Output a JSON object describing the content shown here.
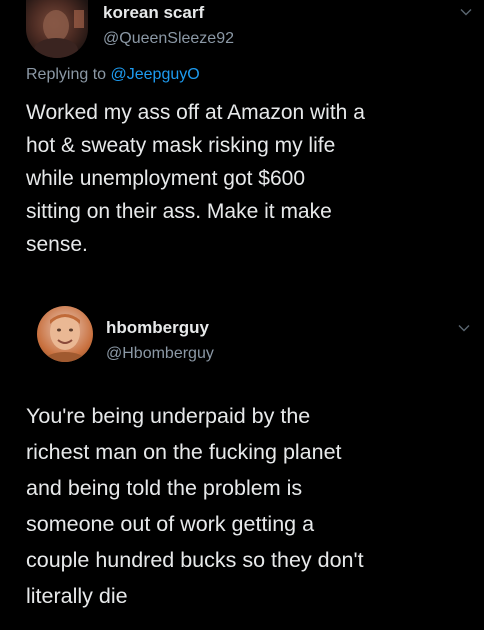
{
  "tweet1": {
    "display_name": "korean scarf",
    "handle": "@QueenSleeze92",
    "replying_label": "Replying to",
    "replying_to": "@JeepguyO",
    "text_lines": [
      "Worked my ass off at Amazon with a",
      "hot & sweaty mask risking my life",
      "while unemployment got $600",
      "sitting on their ass. Make it make",
      "sense."
    ]
  },
  "tweet2": {
    "display_name": "hbomberguy",
    "handle": "@Hbomberguy",
    "text_lines": [
      "You're being underpaid by the",
      "richest man on the fucking planet",
      "and being told the problem is",
      "someone out of work getting a",
      "couple hundred bucks so they don't",
      "literally die"
    ]
  },
  "icons": {
    "more_menu": "chevron-down-icon"
  },
  "colors": {
    "background": "#000000",
    "text": "#e7e9ea",
    "secondary": "#8b98a5",
    "mention": "#1d9bf0"
  }
}
